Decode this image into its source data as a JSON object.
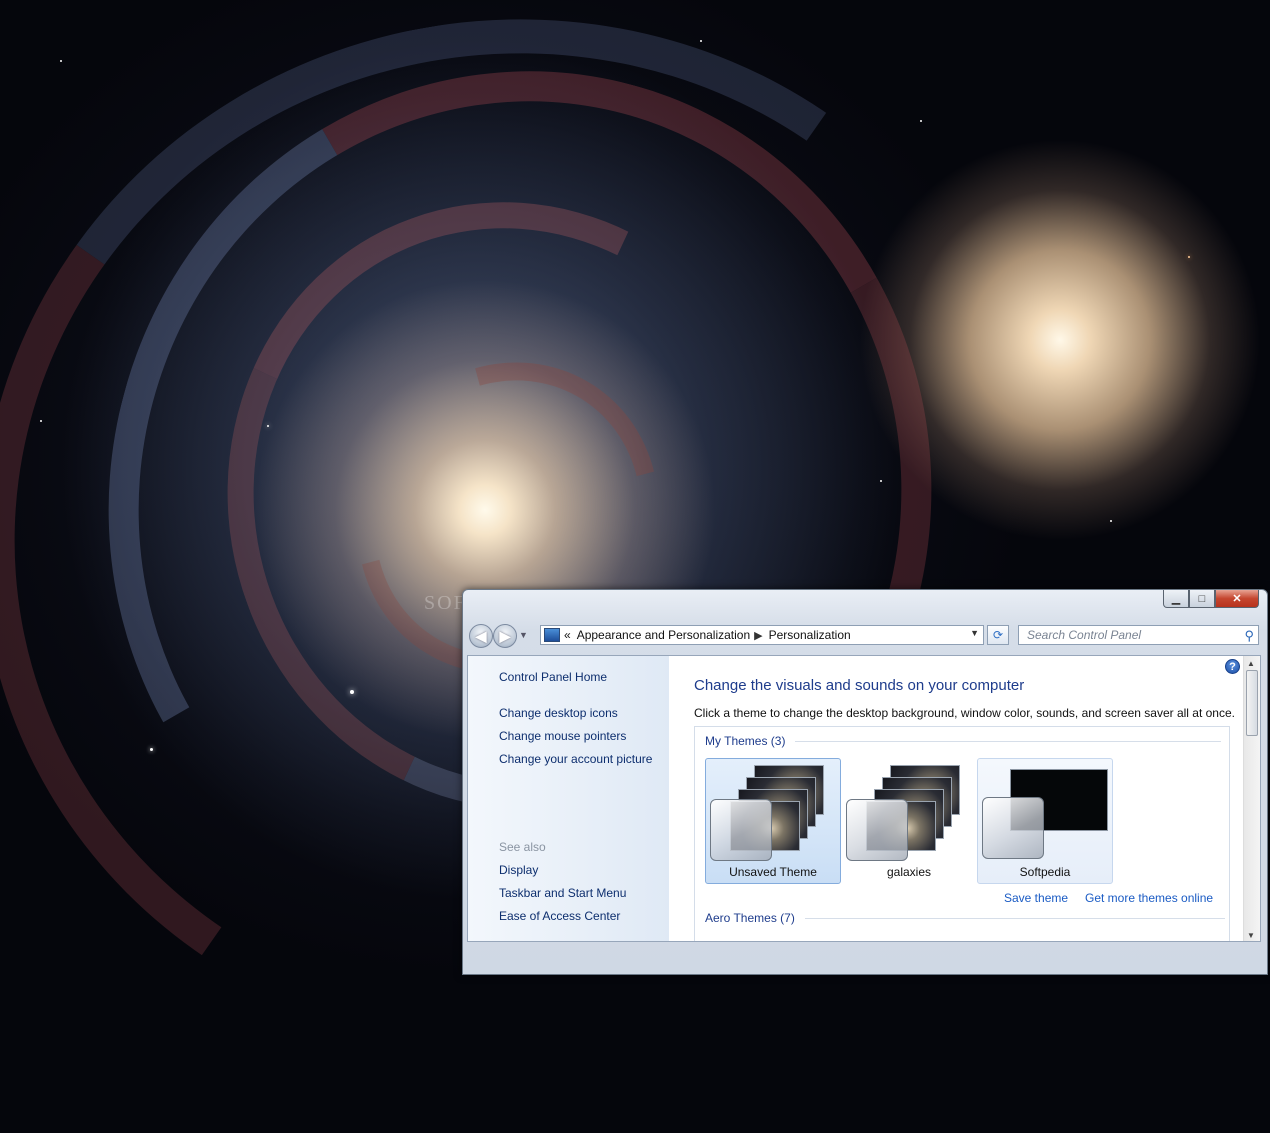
{
  "desktop": {
    "watermark": "SOFTPEDIA"
  },
  "window": {
    "caption_buttons": {
      "minimize_icon": "minimize-icon",
      "maximize_icon": "maximize-icon",
      "close_icon": "close-icon",
      "minimize_glyph": "▁",
      "maximize_glyph": "□",
      "close_glyph": "✕"
    },
    "nav": {
      "back_glyph": "◀",
      "forward_glyph": "▶",
      "recent_glyph": "▼",
      "overflow": "«",
      "breadcrumbs": [
        "Appearance and Personalization",
        "Personalization"
      ],
      "crumb_separator": "▶",
      "dropdown_glyph": "▼",
      "refresh_glyph": "⟳"
    },
    "search": {
      "placeholder": "Search Control Panel",
      "icon": "search-icon",
      "glyph": "⚲"
    },
    "sidebar": {
      "home": "Control Panel Home",
      "tasks": [
        "Change desktop icons",
        "Change mouse pointers",
        "Change your account picture"
      ],
      "see_also_label": "See also",
      "see_also": [
        "Display",
        "Taskbar and Start Menu",
        "Ease of Access Center"
      ]
    },
    "main": {
      "help_glyph": "?",
      "title": "Change the visuals and sounds on your computer",
      "subtitle": "Click a theme to change the desktop background, window color, sounds, and screen saver all at once.",
      "my_themes_header": "My Themes (3)",
      "themes": [
        {
          "name": "Unsaved Theme",
          "selected": true
        },
        {
          "name": "galaxies",
          "selected": false
        },
        {
          "name": "Softpedia",
          "selected": false
        }
      ],
      "save_theme": "Save theme",
      "get_more_themes": "Get more themes online",
      "aero_themes_header": "Aero Themes (7)"
    },
    "scrollbar": {
      "up_glyph": "▲",
      "down_glyph": "▼"
    }
  }
}
